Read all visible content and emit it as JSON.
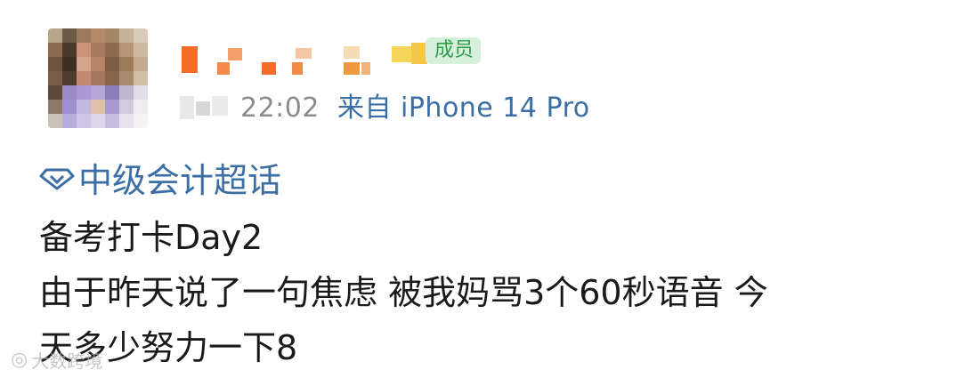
{
  "post": {
    "member_badge": "成员",
    "time": "22:02",
    "source": "来自 iPhone 14 Pro",
    "topic": "中级会计超话",
    "lines": [
      "备考打卡Day2",
      "由于昨天说了一句焦虑 被我妈骂3个60秒语音 今",
      "天多少努力一下8"
    ]
  },
  "watermark": {
    "text": "大数跨境"
  },
  "icons": {
    "topic": "diamond-topic-icon",
    "watermark": "weibo-logo-icon"
  },
  "colors": {
    "link_blue": "#3a6ea5",
    "meta_gray": "#8c8c8c",
    "badge_green": "#2f9e4b"
  }
}
